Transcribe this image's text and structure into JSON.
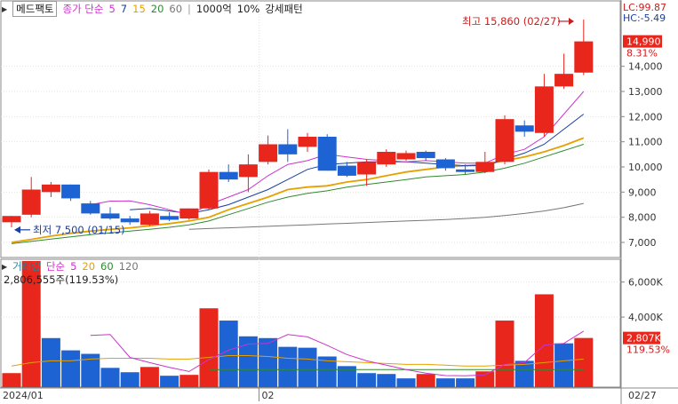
{
  "header": {
    "stock_name": "메드팩토",
    "price_legend": {
      "label": "종가 단순",
      "periods": [
        "5",
        "7",
        "15",
        "20",
        "60"
      ]
    },
    "extra_labels": [
      "1000억",
      "10%",
      "강세패턴"
    ],
    "lc_label": "LC:99.87",
    "hc_label": "HC:-5.49"
  },
  "volume_legend": {
    "label": "거래량",
    "sub": "단순",
    "periods": [
      "5",
      "20",
      "60",
      "120"
    ],
    "current": "2,806,555주(119.53%)"
  },
  "colors": {
    "up": "#e8261c",
    "down": "#1d63d3",
    "ma5": "#cc33cc",
    "ma7": "#1a3fa0",
    "ma15": "#e6a100",
    "ma20": "#2e8b2e",
    "ma60": "#777777",
    "vol_ma5": "#cc33cc",
    "vol_ma20": "#e6a100",
    "vol_ma60": "#2e8b2e"
  },
  "chart_data": [
    {
      "type": "candlestick",
      "title": "",
      "ylim": [
        6400,
        16600
      ],
      "y_ticks": [
        "7,000",
        "8,000",
        "9,000",
        "10,000",
        "11,000",
        "12,000",
        "13,000",
        "14,000"
      ],
      "x_labels": [
        "2024/01",
        "02",
        "02/27"
      ],
      "candles": [
        {
          "o": 7800,
          "h": 8050,
          "l": 7600,
          "c": 8050
        },
        {
          "o": 8100,
          "h": 9600,
          "l": 8000,
          "c": 9100
        },
        {
          "o": 9000,
          "h": 9400,
          "l": 8800,
          "c": 9300
        },
        {
          "o": 9300,
          "h": 9300,
          "l": 8650,
          "c": 8750
        },
        {
          "o": 8550,
          "h": 8650,
          "l": 8100,
          "c": 8150
        },
        {
          "o": 8150,
          "h": 8400,
          "l": 7900,
          "c": 7950
        },
        {
          "o": 7950,
          "h": 8050,
          "l": 7700,
          "c": 7800
        },
        {
          "o": 7700,
          "h": 8250,
          "l": 7650,
          "c": 8150
        },
        {
          "o": 8050,
          "h": 8200,
          "l": 7850,
          "c": 7900
        },
        {
          "o": 7950,
          "h": 8350,
          "l": 7900,
          "c": 8350
        },
        {
          "o": 8350,
          "h": 9900,
          "l": 8300,
          "c": 9800
        },
        {
          "o": 9800,
          "h": 10100,
          "l": 9400,
          "c": 9500
        },
        {
          "o": 9600,
          "h": 10500,
          "l": 9000,
          "c": 10100
        },
        {
          "o": 10200,
          "h": 11250,
          "l": 10100,
          "c": 10900
        },
        {
          "o": 10900,
          "h": 11500,
          "l": 10200,
          "c": 10500
        },
        {
          "o": 10800,
          "h": 11350,
          "l": 10600,
          "c": 11200
        },
        {
          "o": 11200,
          "h": 11300,
          "l": 9850,
          "c": 9850
        },
        {
          "o": 10050,
          "h": 10200,
          "l": 9600,
          "c": 9650
        },
        {
          "o": 9700,
          "h": 10300,
          "l": 9250,
          "c": 10200
        },
        {
          "o": 10100,
          "h": 10700,
          "l": 10000,
          "c": 10600
        },
        {
          "o": 10300,
          "h": 10650,
          "l": 10250,
          "c": 10550
        },
        {
          "o": 10600,
          "h": 10650,
          "l": 10250,
          "c": 10350
        },
        {
          "o": 10300,
          "h": 10350,
          "l": 9850,
          "c": 9950
        },
        {
          "o": 9900,
          "h": 10100,
          "l": 9700,
          "c": 9800
        },
        {
          "o": 9800,
          "h": 10600,
          "l": 9750,
          "c": 10200
        },
        {
          "o": 10200,
          "h": 12050,
          "l": 10100,
          "c": 11900
        },
        {
          "o": 11650,
          "h": 11850,
          "l": 11200,
          "c": 11400
        },
        {
          "o": 11350,
          "h": 13700,
          "l": 11200,
          "c": 13200
        },
        {
          "o": 13200,
          "h": 14500,
          "l": 13100,
          "c": 13700
        },
        {
          "o": 13750,
          "h": 15860,
          "l": 13650,
          "c": 14990
        }
      ],
      "ma": {
        "ma5": [
          null,
          null,
          null,
          null,
          8500,
          8640,
          8650,
          8500,
          8300,
          8100,
          8500,
          8800,
          9100,
          9650,
          10100,
          10250,
          10500,
          10400,
          10300,
          10250,
          10200,
          10250,
          10200,
          10150,
          10150,
          10500,
          10700,
          11200,
          12100,
          13000
        ],
        "ma7": [
          null,
          null,
          null,
          null,
          null,
          null,
          8300,
          8350,
          8250,
          8150,
          8300,
          8500,
          8800,
          9100,
          9500,
          9900,
          10100,
          10150,
          10200,
          10200,
          10200,
          10150,
          10100,
          10050,
          10050,
          10300,
          10550,
          10900,
          11500,
          12100
        ],
        "ma15": [
          7000,
          7120,
          7250,
          7360,
          7450,
          7520,
          7580,
          7660,
          7750,
          7850,
          8000,
          8300,
          8550,
          8800,
          9100,
          9200,
          9250,
          9400,
          9500,
          9650,
          9800,
          9900,
          10000,
          10050,
          10100,
          10250,
          10400,
          10600,
          10850,
          11150
        ],
        "ma20": [
          6950,
          7040,
          7130,
          7220,
          7310,
          7380,
          7450,
          7520,
          7600,
          7700,
          7850,
          8100,
          8350,
          8600,
          8800,
          8950,
          9050,
          9200,
          9300,
          9400,
          9500,
          9600,
          9650,
          9700,
          9800,
          9950,
          10150,
          10400,
          10650,
          10900
        ],
        "ma60": [
          null,
          null,
          null,
          null,
          null,
          null,
          null,
          null,
          null,
          7520,
          7550,
          7580,
          7610,
          7640,
          7670,
          7700,
          7730,
          7760,
          7790,
          7820,
          7850,
          7880,
          7910,
          7950,
          8000,
          8070,
          8150,
          8250,
          8380,
          8550
        ]
      },
      "annotations": {
        "high": {
          "text": "최고 15,860 (02/27)",
          "value": 15860
        },
        "low": {
          "text": "최저 7,500 (01/15)",
          "value": 7500
        }
      },
      "current": {
        "price": "14,990",
        "change": "8.31%"
      }
    },
    {
      "type": "bar",
      "title": "",
      "series_name": "거래량",
      "ylim": [
        0,
        7300000
      ],
      "y_ticks": [
        "4,000K",
        "6,000K"
      ],
      "values": [
        800000,
        7200000,
        2800000,
        2100000,
        1900000,
        1100000,
        850000,
        1150000,
        650000,
        700000,
        4500000,
        3800000,
        2900000,
        2800000,
        2300000,
        2250000,
        1750000,
        1200000,
        800000,
        750000,
        500000,
        750000,
        500000,
        500000,
        900000,
        3800000,
        1500000,
        5300000,
        2500000,
        2806555
      ],
      "up": [
        1,
        1,
        0,
        0,
        0,
        0,
        0,
        1,
        0,
        1,
        1,
        0,
        0,
        0,
        0,
        0,
        0,
        0,
        0,
        0,
        0,
        1,
        0,
        0,
        1,
        1,
        0,
        1,
        0,
        1
      ],
      "ma": {
        "ma5": [
          null,
          null,
          null,
          null,
          2950,
          3000,
          1700,
          1400,
          1130,
          890,
          1570,
          2110,
          2460,
          2500,
          3000,
          2870,
          2390,
          1860,
          1500,
          1250,
          1000,
          800,
          660,
          650,
          700,
          1300,
          1400,
          2400,
          2500,
          3200
        ],
        "ma20": [
          1200,
          1400,
          1500,
          1500,
          1600,
          1650,
          1650,
          1650,
          1600,
          1600,
          1700,
          1800,
          1800,
          1750,
          1650,
          1600,
          1500,
          1450,
          1400,
          1350,
          1300,
          1300,
          1250,
          1200,
          1200,
          1250,
          1300,
          1400,
          1500,
          1600
        ],
        "ma60": [
          null,
          null,
          null,
          null,
          null,
          null,
          null,
          null,
          null,
          null,
          1000,
          1000,
          1000,
          1000,
          1000,
          1000,
          1000,
          1000,
          1000,
          1000,
          1000,
          1000,
          1000,
          1000,
          1000,
          1000,
          1000,
          1000,
          1000,
          1000
        ]
      },
      "current": {
        "volume": "2,807K",
        "ratio": "119.53%"
      }
    }
  ]
}
